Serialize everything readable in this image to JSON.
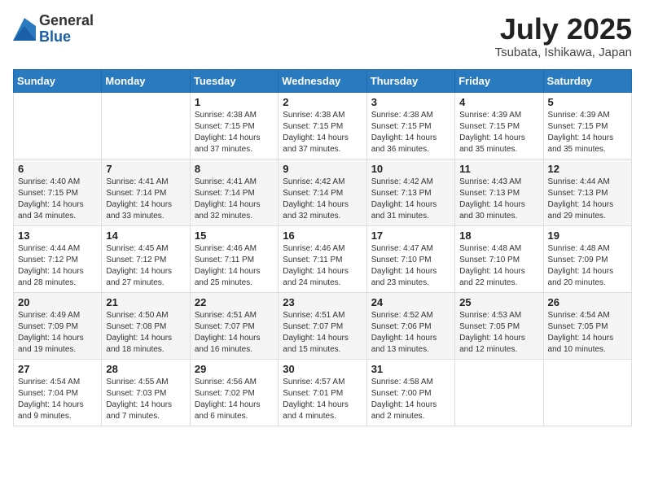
{
  "logo": {
    "general": "General",
    "blue": "Blue"
  },
  "title": {
    "month_year": "July 2025",
    "location": "Tsubata, Ishikawa, Japan"
  },
  "weekdays": [
    "Sunday",
    "Monday",
    "Tuesday",
    "Wednesday",
    "Thursday",
    "Friday",
    "Saturday"
  ],
  "weeks": [
    [
      {
        "day": "",
        "info": ""
      },
      {
        "day": "",
        "info": ""
      },
      {
        "day": "1",
        "info": "Sunrise: 4:38 AM\nSunset: 7:15 PM\nDaylight: 14 hours\nand 37 minutes."
      },
      {
        "day": "2",
        "info": "Sunrise: 4:38 AM\nSunset: 7:15 PM\nDaylight: 14 hours\nand 37 minutes."
      },
      {
        "day": "3",
        "info": "Sunrise: 4:38 AM\nSunset: 7:15 PM\nDaylight: 14 hours\nand 36 minutes."
      },
      {
        "day": "4",
        "info": "Sunrise: 4:39 AM\nSunset: 7:15 PM\nDaylight: 14 hours\nand 35 minutes."
      },
      {
        "day": "5",
        "info": "Sunrise: 4:39 AM\nSunset: 7:15 PM\nDaylight: 14 hours\nand 35 minutes."
      }
    ],
    [
      {
        "day": "6",
        "info": "Sunrise: 4:40 AM\nSunset: 7:15 PM\nDaylight: 14 hours\nand 34 minutes."
      },
      {
        "day": "7",
        "info": "Sunrise: 4:41 AM\nSunset: 7:14 PM\nDaylight: 14 hours\nand 33 minutes."
      },
      {
        "day": "8",
        "info": "Sunrise: 4:41 AM\nSunset: 7:14 PM\nDaylight: 14 hours\nand 32 minutes."
      },
      {
        "day": "9",
        "info": "Sunrise: 4:42 AM\nSunset: 7:14 PM\nDaylight: 14 hours\nand 32 minutes."
      },
      {
        "day": "10",
        "info": "Sunrise: 4:42 AM\nSunset: 7:13 PM\nDaylight: 14 hours\nand 31 minutes."
      },
      {
        "day": "11",
        "info": "Sunrise: 4:43 AM\nSunset: 7:13 PM\nDaylight: 14 hours\nand 30 minutes."
      },
      {
        "day": "12",
        "info": "Sunrise: 4:44 AM\nSunset: 7:13 PM\nDaylight: 14 hours\nand 29 minutes."
      }
    ],
    [
      {
        "day": "13",
        "info": "Sunrise: 4:44 AM\nSunset: 7:12 PM\nDaylight: 14 hours\nand 28 minutes."
      },
      {
        "day": "14",
        "info": "Sunrise: 4:45 AM\nSunset: 7:12 PM\nDaylight: 14 hours\nand 27 minutes."
      },
      {
        "day": "15",
        "info": "Sunrise: 4:46 AM\nSunset: 7:11 PM\nDaylight: 14 hours\nand 25 minutes."
      },
      {
        "day": "16",
        "info": "Sunrise: 4:46 AM\nSunset: 7:11 PM\nDaylight: 14 hours\nand 24 minutes."
      },
      {
        "day": "17",
        "info": "Sunrise: 4:47 AM\nSunset: 7:10 PM\nDaylight: 14 hours\nand 23 minutes."
      },
      {
        "day": "18",
        "info": "Sunrise: 4:48 AM\nSunset: 7:10 PM\nDaylight: 14 hours\nand 22 minutes."
      },
      {
        "day": "19",
        "info": "Sunrise: 4:48 AM\nSunset: 7:09 PM\nDaylight: 14 hours\nand 20 minutes."
      }
    ],
    [
      {
        "day": "20",
        "info": "Sunrise: 4:49 AM\nSunset: 7:09 PM\nDaylight: 14 hours\nand 19 minutes."
      },
      {
        "day": "21",
        "info": "Sunrise: 4:50 AM\nSunset: 7:08 PM\nDaylight: 14 hours\nand 18 minutes."
      },
      {
        "day": "22",
        "info": "Sunrise: 4:51 AM\nSunset: 7:07 PM\nDaylight: 14 hours\nand 16 minutes."
      },
      {
        "day": "23",
        "info": "Sunrise: 4:51 AM\nSunset: 7:07 PM\nDaylight: 14 hours\nand 15 minutes."
      },
      {
        "day": "24",
        "info": "Sunrise: 4:52 AM\nSunset: 7:06 PM\nDaylight: 14 hours\nand 13 minutes."
      },
      {
        "day": "25",
        "info": "Sunrise: 4:53 AM\nSunset: 7:05 PM\nDaylight: 14 hours\nand 12 minutes."
      },
      {
        "day": "26",
        "info": "Sunrise: 4:54 AM\nSunset: 7:05 PM\nDaylight: 14 hours\nand 10 minutes."
      }
    ],
    [
      {
        "day": "27",
        "info": "Sunrise: 4:54 AM\nSunset: 7:04 PM\nDaylight: 14 hours\nand 9 minutes."
      },
      {
        "day": "28",
        "info": "Sunrise: 4:55 AM\nSunset: 7:03 PM\nDaylight: 14 hours\nand 7 minutes."
      },
      {
        "day": "29",
        "info": "Sunrise: 4:56 AM\nSunset: 7:02 PM\nDaylight: 14 hours\nand 6 minutes."
      },
      {
        "day": "30",
        "info": "Sunrise: 4:57 AM\nSunset: 7:01 PM\nDaylight: 14 hours\nand 4 minutes."
      },
      {
        "day": "31",
        "info": "Sunrise: 4:58 AM\nSunset: 7:00 PM\nDaylight: 14 hours\nand 2 minutes."
      },
      {
        "day": "",
        "info": ""
      },
      {
        "day": "",
        "info": ""
      }
    ]
  ]
}
